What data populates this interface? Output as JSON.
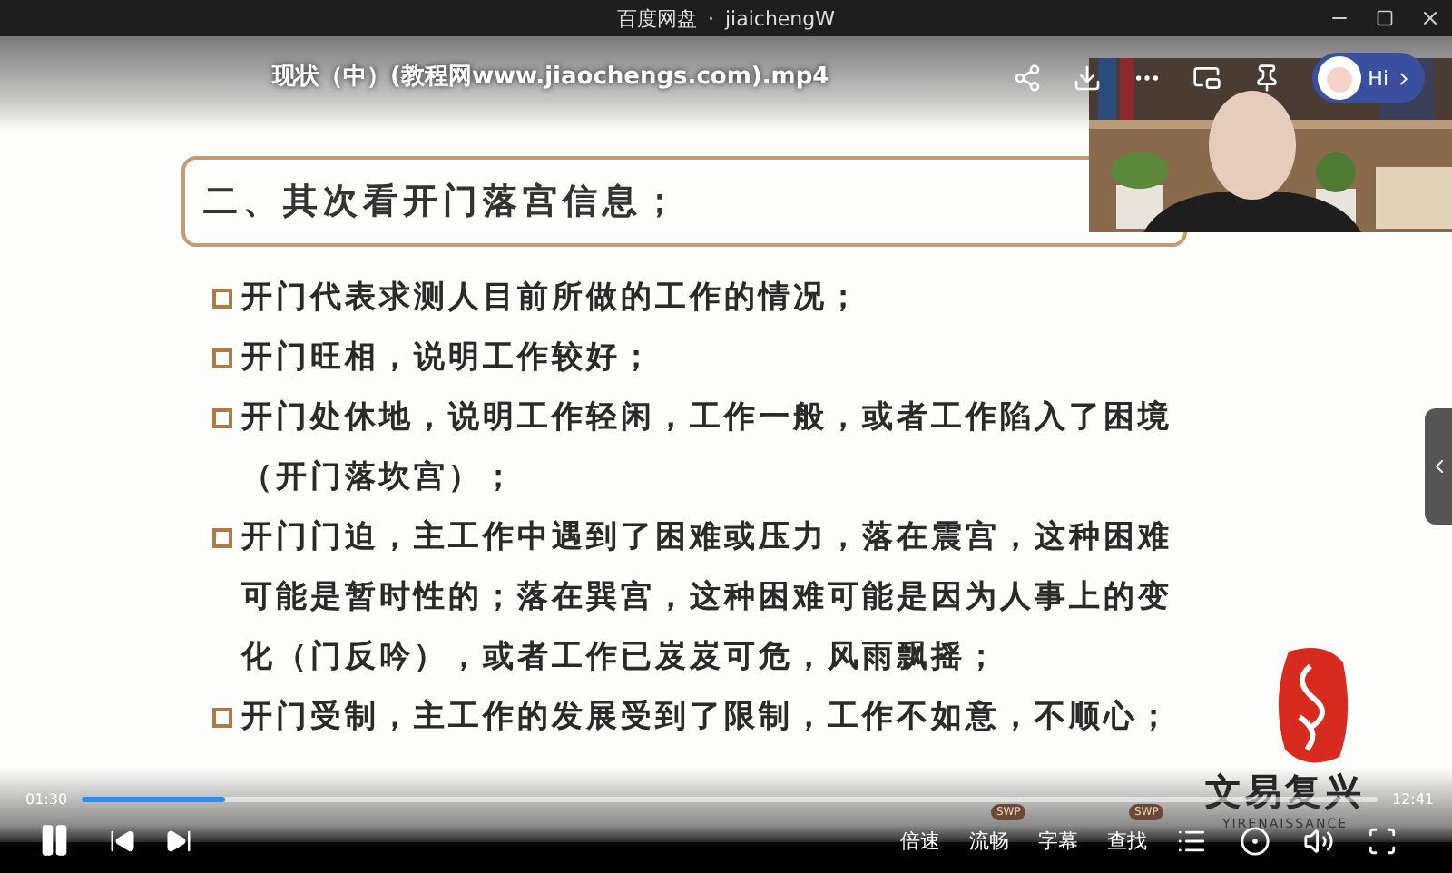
{
  "window": {
    "title": "百度网盘",
    "separator": "·",
    "account": "jiaichengW"
  },
  "video": {
    "title": "现状（中）(教程网www.jiaochengs.com).mp4"
  },
  "assistant": {
    "greeting": "Hi"
  },
  "slide": {
    "heading": "二、其次看开门落宫信息；",
    "bullets": [
      "开门代表求测人目前所做的工作的情况；",
      "开门旺相，说明工作较好；",
      "开门处休地，说明工作轻闲，工作一般，或者工作陷入了困境（开门落坎宫）；",
      "开门门迫，主工作中遇到了困难或压力，落在震宫，这种困难可能是暂时性的；落在巽宫，这种困难可能是因为人事上的变化（门反吟），或者工作已岌岌可危，风雨飘摇；",
      "开门受制，主工作的发展受到了限制，工作不如意，不顺心；"
    ],
    "logo": {
      "name": "文易复兴",
      "latin": "YIRENAISSANCE"
    }
  },
  "player": {
    "elapsed": "01:30",
    "total": "12:41",
    "level": 0.11,
    "playing": true,
    "controls": [
      {
        "label": "倍速"
      },
      {
        "label": "流畅",
        "badge": "SWP"
      },
      {
        "label": "字幕"
      },
      {
        "label": "查找",
        "badge": "SWP"
      }
    ]
  }
}
